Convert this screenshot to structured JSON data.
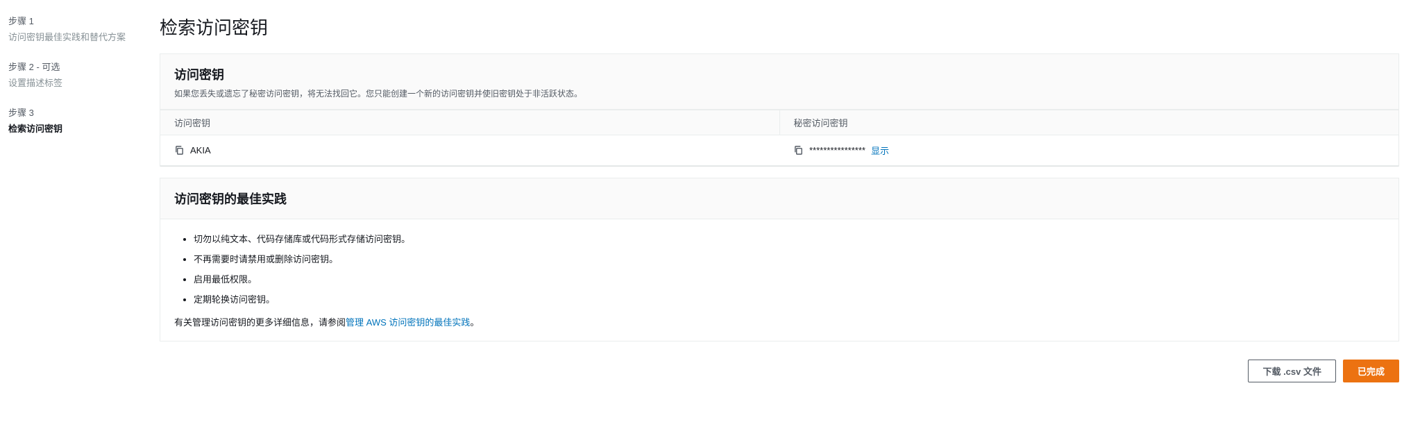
{
  "sidebar": {
    "steps": [
      {
        "label": "步骤 1",
        "title": "访问密钥最佳实践和替代方案"
      },
      {
        "label": "步骤 2 - 可选",
        "title": "设置描述标签"
      },
      {
        "label": "步骤 3",
        "title": "检索访问密钥"
      }
    ]
  },
  "page": {
    "title": "检索访问密钥"
  },
  "access_key_panel": {
    "title": "访问密钥",
    "description": "如果您丢失或遗忘了秘密访问密钥，将无法找回它。您只能创建一个新的访问密钥并使旧密钥处于非活跃状态。",
    "col1_header": "访问密钥",
    "col2_header": "秘密访问密钥",
    "access_key": "AKIA",
    "secret_key_masked": "****************",
    "show_label": "显示"
  },
  "best_practices": {
    "title": "访问密钥的最佳实践",
    "items": [
      "切勿以纯文本、代码存储库或代码形式存储访问密钥。",
      "不再需要时请禁用或删除访问密钥。",
      "启用最低权限。",
      "定期轮换访问密钥。"
    ],
    "footer_prefix": "有关管理访问密钥的更多详细信息，请参阅",
    "footer_link": "管理 AWS 访问密钥的最佳实践",
    "footer_suffix": "。"
  },
  "actions": {
    "download_csv": "下载 .csv 文件",
    "done": "已完成"
  }
}
